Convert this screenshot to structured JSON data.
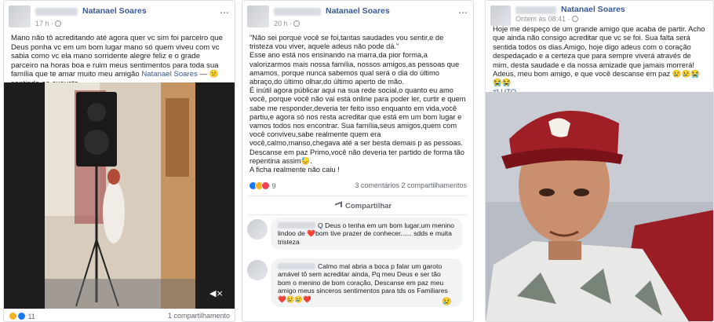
{
  "post1": {
    "author": "Natanael Soares",
    "time": "17 h ·",
    "more_icon": "more-dots-icon",
    "text": "Mano não tô acreditando até agora quer vc sim foi parceiro que Deus ponha vc em um bom lugar mano só quem viveu com vc sabia como vc ela mano sorridente alegre feliz e o grade parceiro na horas boa e ruim meus sentimentos para toda sua família que te amar muito meu amigão",
    "tag_name": "Natanael Soares",
    "feeling": " — 😕 sentindo-se exausto.",
    "reaction_count": "11",
    "shares": "1 compartilhamento",
    "video_icon": "volume-icon"
  },
  "post2": {
    "author": "Natanael Soares",
    "time": "20 h ·",
    "text_lines": [
      "\"Não sei porque você se foi,tantas saudades vou sentir,e de tristeza vou viver, aquele adeus não pode dá.\"",
      "Esse ano está nos ensinando na marra,da pior forma,a valorizarmos mais nossa família, nossos amigos,as pessoas que amamos, porque nunca sabemos qual será o dia do último abraço,do último olhar,do último aperto de mão.",
      "É inútil agora públicar aqui na sua rede social,o quanto eu amo você, porque você não vai está online para poder ler, curtir e quem sabe me responder,deveria ter feito isso enquanto em vida,você partiu,e agora só nos resta acreditar que está em um bom lugar e vamos todos nos encontrar. Sua família,seus amigos,quem com você conviveu,sabe realmente quem era você,calmo,manso,chegava até a ser besta demais p as pessoas.",
      "Descanse em paz Primo,você não deveria ter partido de forma tão repentina assim😓.",
      "A ficha realmente não caiu !"
    ],
    "reaction_count": "9",
    "comments_shares": "3 comentários  2 compartilhamentos",
    "share_label": "Compartilhar",
    "comment1": "Q Deus o tenha em um bom lugar,um menino lindoo de ❤️bom tive prazer de conhecer...... sdds e muita tristeza",
    "comment2": "Calmo mal abria a boca p falar um garoto amável tô sem acreditar ainda, Pq meu Deus e ser tão bom o menino de bom coração, Descanse em paz meu amigo meus sinceros sentimentos para tds os Familiares ❤️😢😢❤️"
  },
  "post3": {
    "author": "Natanael Soares",
    "time": "Ontem às 08:41 ·",
    "text": "Hoje me despeço de um grande amigo que acaba de partir. Acho que ainda não consigo acreditar que vc se foi. Sua falta será sentida todos os dias.Amigo, hoje digo adeus com o coração despedaçado e a certeza que para sempre viverá através de mim, desta saudade e da nossa amizade que jamais morrerá! Adeus, meu bom amigo, e que você descanse em paz 😢😢😭😭😭",
    "hashtag": "#LUTO"
  }
}
